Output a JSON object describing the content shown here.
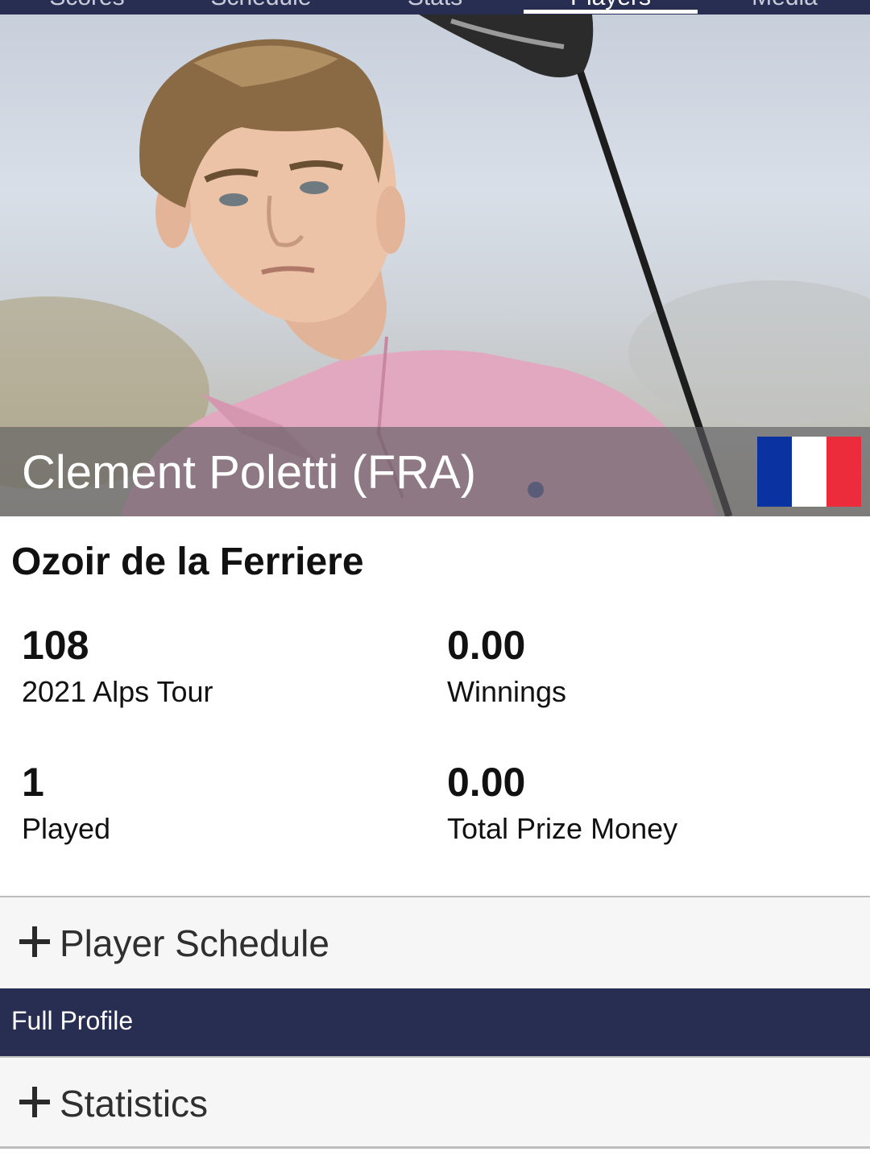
{
  "nav": {
    "tabs": [
      "Scores",
      "Schedule",
      "Stats",
      "Players",
      "Media"
    ],
    "active_tab": "Players"
  },
  "player": {
    "name": "Clement Poletti (FRA)",
    "club": "Ozoir de la Ferriere",
    "flag_colors": [
      "#0a32a0",
      "#ffffff",
      "#ec2c3a"
    ]
  },
  "stats": {
    "rank": {
      "value": "108",
      "label": "2021 Alps Tour"
    },
    "winnings": {
      "value": "0.00",
      "label": "Winnings"
    },
    "played": {
      "value": "1",
      "label": "Played"
    },
    "prize_money": {
      "value": "0.00",
      "label": "Total Prize Money"
    }
  },
  "sections": {
    "player_schedule": "Player Schedule",
    "full_profile": "Full Profile",
    "statistics": "Statistics"
  },
  "colors": {
    "nav_bg": "#282e52",
    "band_bg": "#282e52",
    "row_bg": "#f6f6f6"
  }
}
